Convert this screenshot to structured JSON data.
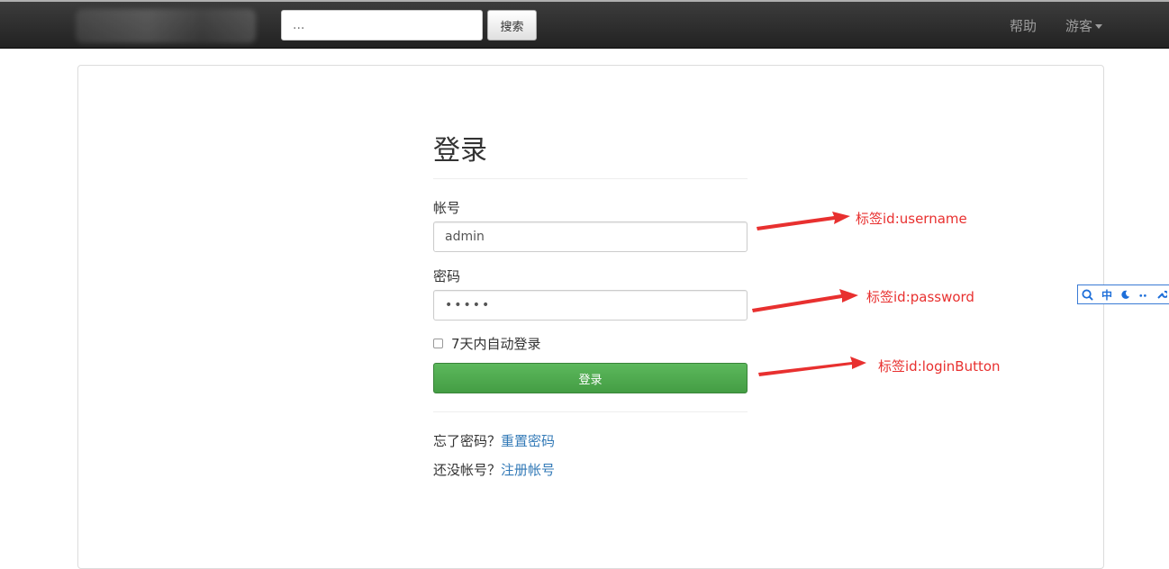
{
  "navbar": {
    "search_placeholder": "...",
    "search_button": "搜索",
    "help_label": "帮助",
    "guest_label": "游客"
  },
  "login": {
    "title": "登录",
    "username_label": "帐号",
    "username_value": "admin",
    "password_label": "密码",
    "password_value": "•••••",
    "remember_label": "7天内自动登录",
    "login_button": "登录",
    "forgot_prefix": "忘了密码？",
    "forgot_link": "重置密码",
    "register_prefix": "还没帐号？",
    "register_link": "注册帐号"
  },
  "annotations": {
    "username": "标签id:username",
    "password": "标签id:password",
    "login_button": "标签id:loginButton",
    "color": "#e8302f"
  },
  "ime": {
    "mode": "中",
    "icons": [
      "search-icon",
      "moon-icon",
      "punctuation-icon",
      "wrench-icon"
    ]
  },
  "colors": {
    "navbar_bg": "#222222",
    "primary_green": "#5cb85c",
    "link_blue": "#337ab7"
  }
}
